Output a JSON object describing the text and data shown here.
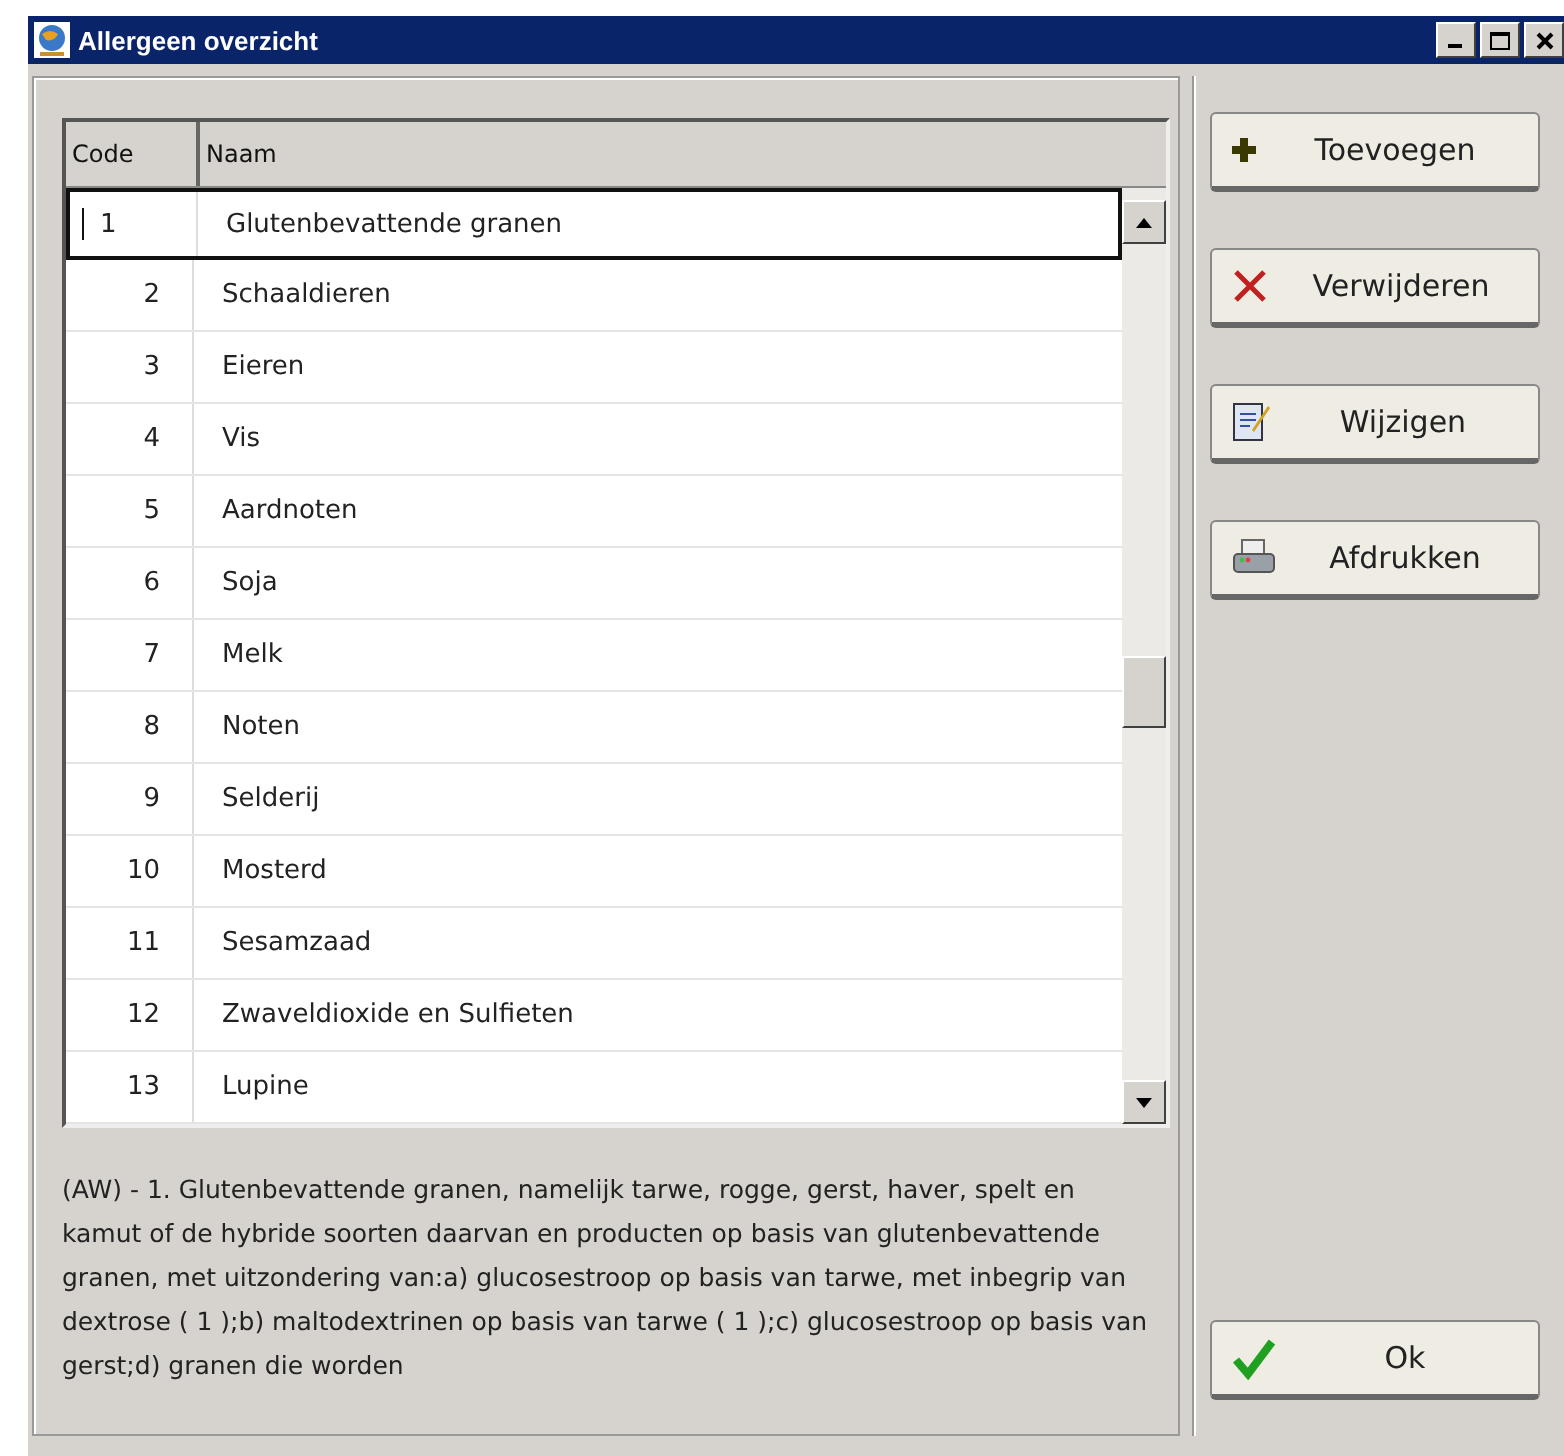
{
  "window": {
    "title": "Allergeen overzicht"
  },
  "table": {
    "columns": [
      "Code",
      "Naam"
    ],
    "rows": [
      {
        "code": "1",
        "name": "Glutenbevattende granen",
        "selected": true
      },
      {
        "code": "2",
        "name": "Schaaldieren",
        "selected": false
      },
      {
        "code": "3",
        "name": "Eieren",
        "selected": false
      },
      {
        "code": "4",
        "name": "Vis",
        "selected": false
      },
      {
        "code": "5",
        "name": "Aardnoten",
        "selected": false
      },
      {
        "code": "6",
        "name": "Soja",
        "selected": false
      },
      {
        "code": "7",
        "name": "Melk",
        "selected": false
      },
      {
        "code": "8",
        "name": "Noten",
        "selected": false
      },
      {
        "code": "9",
        "name": "Selderij",
        "selected": false
      },
      {
        "code": "10",
        "name": "Mosterd",
        "selected": false
      },
      {
        "code": "11",
        "name": "Sesamzaad",
        "selected": false
      },
      {
        "code": "12",
        "name": "Zwaveldioxide en Sulfieten",
        "selected": false
      },
      {
        "code": "13",
        "name": "Lupine",
        "selected": false
      }
    ]
  },
  "description": "(AW) - 1. Glutenbevattende granen, namelijk tarwe, rogge, gerst, haver, spelt en kamut of de hybride soorten daarvan en producten op basis van glutenbevattende granen, met uitzondering van:a) glucosestroop op basis van tarwe, met inbegrip van dextrose ( 1 );b) maltodextrinen op basis van tarwe ( 1 );c) glucosestroop op basis van gerst;d) granen die worden",
  "buttons": [
    {
      "label": "Toevoegen",
      "kind": "add"
    },
    {
      "label": "Verwijderen",
      "kind": "delete"
    },
    {
      "label": "Wijzigen",
      "kind": "edit"
    },
    {
      "label": "Afdrukken",
      "kind": "print"
    }
  ],
  "ok_button": {
    "label": "Ok"
  }
}
